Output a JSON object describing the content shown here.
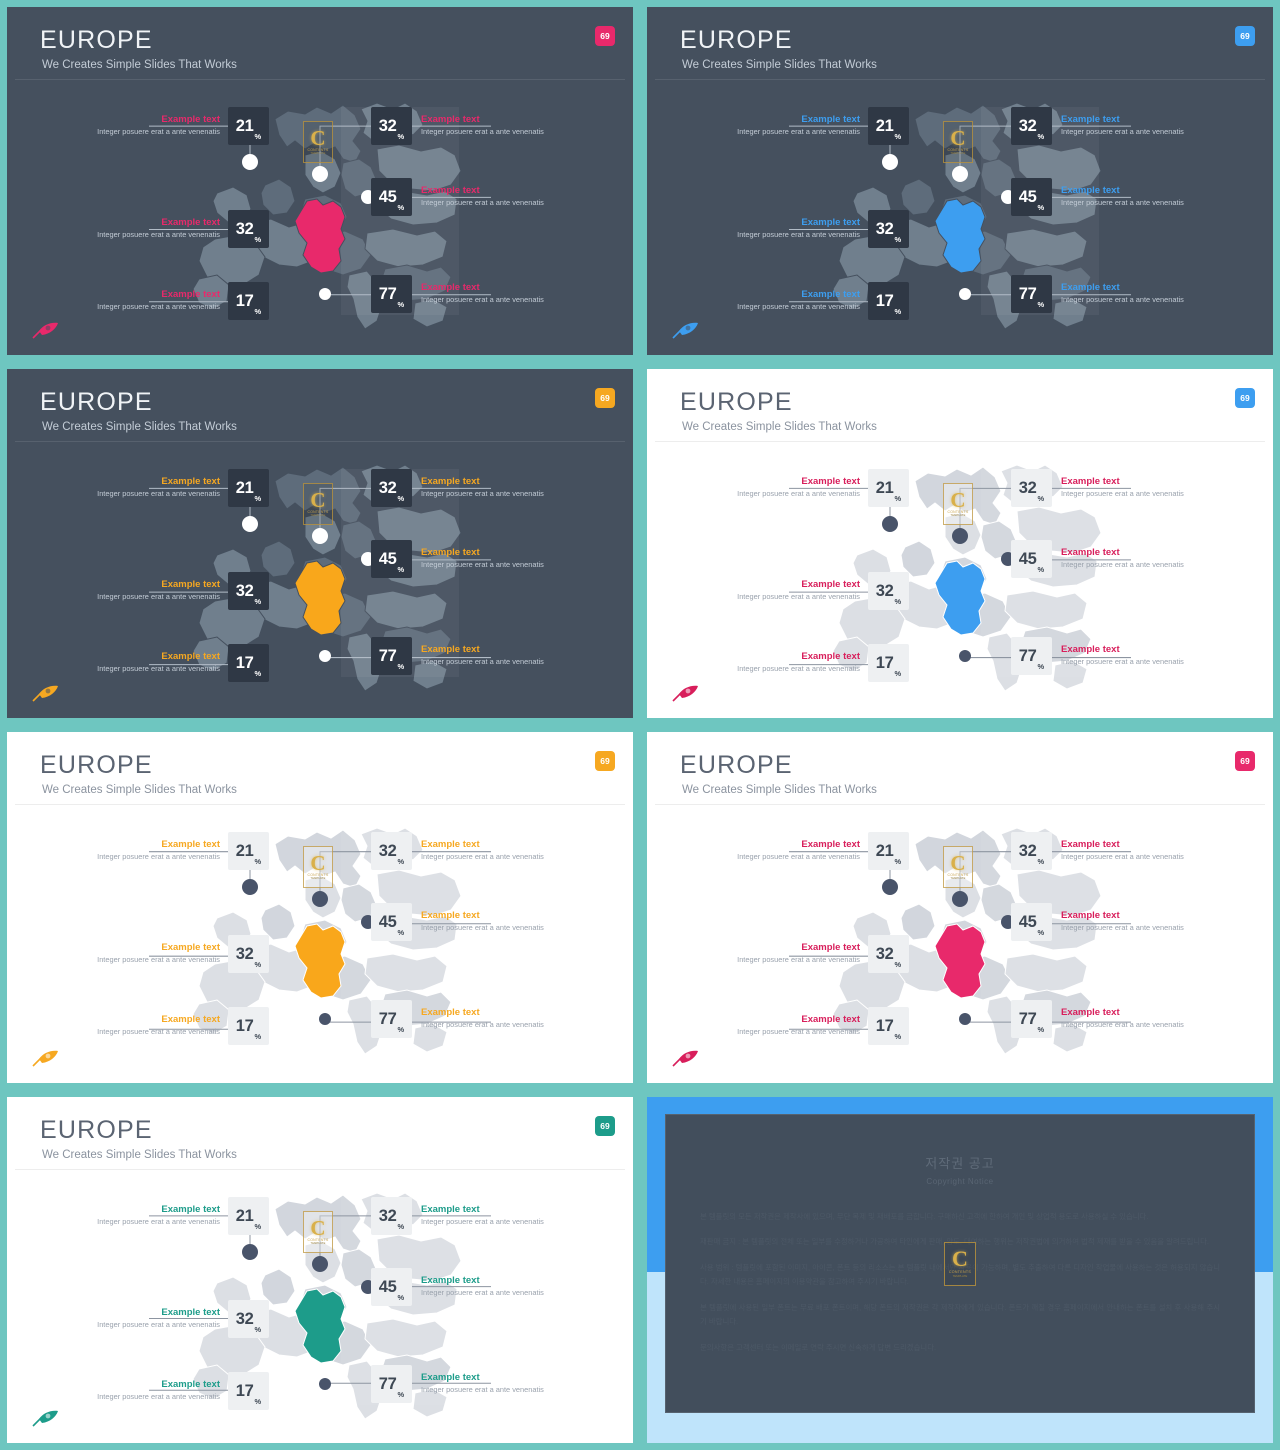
{
  "deck": {
    "common": {
      "title": "EUROPE",
      "subtitle": "We Creates Simple Slides That Works",
      "badge": "69",
      "logo": {
        "glyph": "C",
        "name": "CONTENTS",
        "sub": "TEMPLATE"
      },
      "metrics_left": [
        {
          "heading": "Example text",
          "desc": "Integer posuere erat a ante venenatis",
          "value": "21",
          "unit": "%"
        },
        {
          "heading": "Example text",
          "desc": "Integer posuere erat a ante venenatis",
          "value": "32",
          "unit": "%"
        },
        {
          "heading": "Example text",
          "desc": "Integer posuere erat a ante venenatis",
          "value": "17",
          "unit": "%"
        }
      ],
      "metrics_right": [
        {
          "heading": "Example text",
          "desc": "Integer posuere erat a ante venenatis",
          "value": "32",
          "unit": "%"
        },
        {
          "heading": "Example text",
          "desc": "Integer posuere erat a ante venenatis",
          "value": "45",
          "unit": "%"
        },
        {
          "heading": "Example text",
          "desc": "Integer posuere erat a ante venenatis",
          "value": "77",
          "unit": "%"
        }
      ]
    },
    "slides": [
      {
        "id": "slide-1",
        "theme": "dark",
        "accent": "#e8296b",
        "highlight": "#e8296b",
        "badge_bg": "#e8296b"
      },
      {
        "id": "slide-2",
        "theme": "dark",
        "accent": "#3d9ef0",
        "highlight": "#3d9ef0",
        "badge_bg": "#3d9ef0"
      },
      {
        "id": "slide-3",
        "theme": "dark",
        "accent": "#f6a821",
        "highlight": "#f9a71b",
        "badge_bg": "#f6a821"
      },
      {
        "id": "slide-4",
        "theme": "light",
        "accent": "#d81e5b",
        "highlight": "#3d9ef0",
        "badge_bg": "#3d9ef0"
      },
      {
        "id": "slide-5",
        "theme": "light",
        "accent": "#f6a821",
        "highlight": "#f9a71b",
        "badge_bg": "#f6a821"
      },
      {
        "id": "slide-6",
        "theme": "light",
        "accent": "#d81e5b",
        "highlight": "#e8296b",
        "badge_bg": "#e8296b"
      },
      {
        "id": "slide-7",
        "theme": "light",
        "accent": "#1d9c8a",
        "highlight": "#1d9c8a",
        "badge_bg": "#1d9c8a"
      }
    ],
    "copyright": {
      "title": "저작권 공고",
      "subtitle": "Copyright Notice",
      "paragraphs": [
        "본 템플릿의 모든 저작권은 제작사에 있으며, 무단 복제 및 재배포를 금합니다. 구매하신 고객에 한하여 개인 및 상업적 용도로 사용하실 수 있습니다.",
        "재판매 금지 : 본 템플릿의 전체 또는 일부를 수정하거나 가공하여 타인에게 판매, 양도, 대여하는 행위는 저작권법에 의거하여 법적 제재를 받을 수 있음을 알려드립니다.",
        "사용 범위 : 템플릿에 포함된 이미지, 아이콘, 폰트 등의 리소스는 본 템플릿 내에서만 사용이 가능하며, 별도 추출하여 다른 디자인 작업물에 사용하는 것은 허용되지 않습니다. 자세한 내용은 홈페이지의 이용약관을 참고하여 주시기 바랍니다.",
        "본 템플릿에 사용된 일부 폰트는 무료 배포 폰트이며, 해당 폰트의 저작권은 각 제작자에게 있습니다. 폰트가 깨질 경우 홈페이지에서 안내하는 폰트를 설치 후 사용해 주시기 바랍니다.",
        "문의사항은 고객센터 또는 이메일로 연락 주시면 신속하게 답변 드리겠습니다."
      ],
      "logo": {
        "glyph": "C",
        "name": "CONTENTS",
        "sub": "TEMPLATE"
      }
    }
  }
}
